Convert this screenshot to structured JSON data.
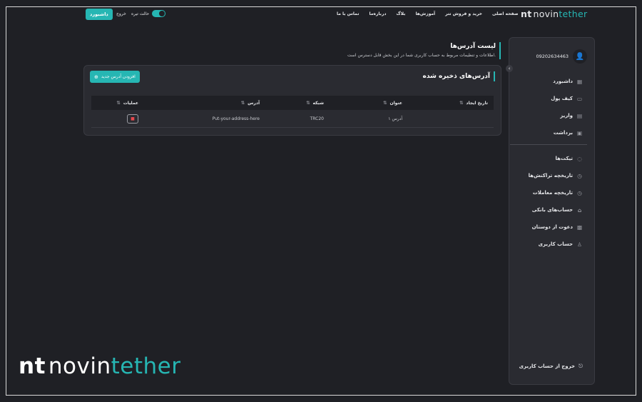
{
  "brand": {
    "mark": "nt",
    "word1": "novin",
    "word2": "tether"
  },
  "topnav": {
    "dashboard_button": "داشبورد",
    "logout": "خروج",
    "dark_mode": "حالت تیره",
    "links": [
      "صفحه اصلی",
      "خرید و فروش تتر",
      "آموزش‌ها",
      "بلاگ",
      "درباره‌ما",
      "تماس با ما"
    ]
  },
  "sidebar": {
    "phone": "09202634463",
    "items_top": [
      {
        "label": "داشبورد",
        "icon": "grid-icon"
      },
      {
        "label": "کیف پول",
        "icon": "wallet-icon"
      },
      {
        "label": "واریز",
        "icon": "deposit-icon"
      },
      {
        "label": "برداشت",
        "icon": "withdraw-icon"
      }
    ],
    "items_bottom": [
      {
        "label": "تیکت‌ها",
        "icon": "chat-icon"
      },
      {
        "label": "تاریخچه تراکنش‌ها",
        "icon": "history-icon"
      },
      {
        "label": "تاریخچه معاملات",
        "icon": "history-icon"
      },
      {
        "label": "حساب‌های بانکی",
        "icon": "bank-icon"
      },
      {
        "label": "دعوت از دوستان",
        "icon": "gift-icon"
      },
      {
        "label": "حساب کاربری",
        "icon": "user-icon"
      }
    ],
    "exit": "خروج از حساب کاربری"
  },
  "page": {
    "title": "لیست آدرس‌ها",
    "subtitle": "اطلاعات و تنظیمات مربوط به حساب کاربری شما در این بخش قابل دسترس است."
  },
  "card": {
    "title": "آدرس‌های ذخیره شده",
    "add_button": "افزودن آدرس جدید",
    "columns": [
      "تاریخ ایجاد",
      "عنوان",
      "شبکه",
      "آدرس",
      "عملیات"
    ],
    "rows": [
      {
        "created": "",
        "title": "آدرس ۱",
        "network": "TRC20",
        "address": "Put-your-address-here"
      }
    ]
  },
  "colors": {
    "accent": "#26b6b3",
    "background": "#1f2025",
    "panel": "#2a2b31",
    "danger": "#e5484d"
  }
}
